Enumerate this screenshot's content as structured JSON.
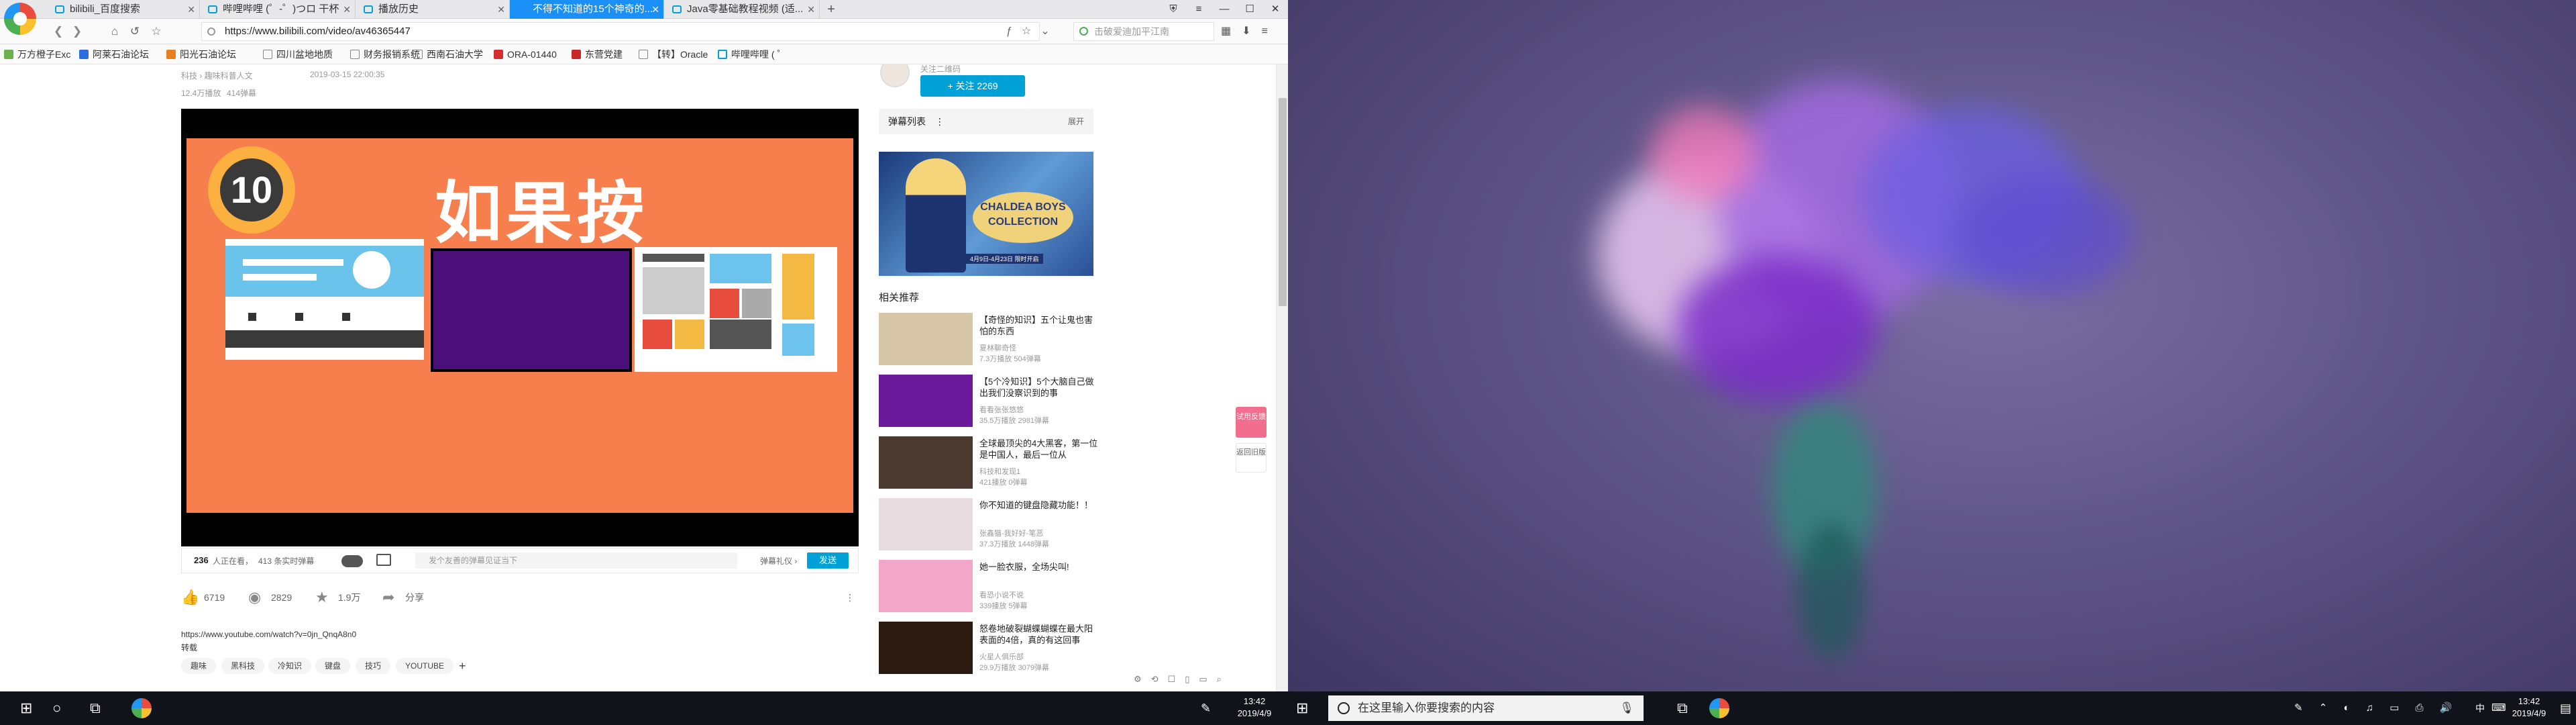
{
  "browser": {
    "tabs": [
      {
        "label": "bilibili_百度搜索",
        "active": false
      },
      {
        "label": "哔哩哔哩 (゜-゜)つロ 干杯",
        "active": false
      },
      {
        "label": "播放历史",
        "active": false
      },
      {
        "label": "不得不知道的15个神奇的...",
        "active": true
      },
      {
        "label": "Java零基础教程视频 (适...",
        "active": false
      }
    ],
    "url": "https://www.bilibili.com/video/av46365447",
    "search_placeholder": "击破爱迪加平江南",
    "bookmarks": [
      "万方橙子Exc",
      "阿莱石油论坛",
      "阳光石油论坛",
      "四川盆地地质",
      "财务报销系统",
      "西南石油大学",
      "ORA-01440",
      "东营党建",
      "【转】Oracle",
      "哔哩哔哩 ( ゜"
    ]
  },
  "video": {
    "category": "科技 › 趣味科普人文",
    "date": "2019-03-15 22:00:35",
    "plays": "12.4万播放",
    "danmaku_count": "414弹幕",
    "frame_badge": "10",
    "frame_title": "如果按",
    "viewers": "236",
    "viewers_suffix": "人正在看，",
    "loaded_danmaku": "413 条实时弹幕",
    "danmu_placeholder": "发个友善的弹幕见证当下",
    "danmu_etiquette": "弹幕礼仪 ›",
    "send_label": "发送",
    "likes": "6719",
    "coins": "2829",
    "favorites": "1.9万",
    "share": "分享",
    "source_url": "https://www.youtube.com/watch?v=0jn_QnqA8n0",
    "source_label": "转载",
    "tags": [
      "趣味",
      "黑科技",
      "冷知识",
      "键盘",
      "技巧",
      "YOUTUBE"
    ]
  },
  "sidebar": {
    "up_sub": "关注二维码",
    "follow_label": "+ 关注 2269",
    "danmu_list_label": "弹幕列表",
    "expand_label": "展开",
    "ad_title": "CHALDEA BOYS COLLECTION",
    "ad_sub": "4月9日-4月23日 限时开启",
    "related_title": "相关推荐",
    "related": [
      {
        "title": "【奇怪的知识】五个让鬼也害怕的东西",
        "up": "夏林聊奇怪",
        "stats": "7.3万播放  504弹幕",
        "color": "#d8c6a8"
      },
      {
        "title": "【5个冷知识】5个大脑自己做出我们没察识到的事",
        "up": "看看张张悠悠",
        "stats": "35.5万播放  2981弹幕",
        "color": "#6a1a9a"
      },
      {
        "title": "全球最顶尖的4大黑客，第一位是中国人，最后一位从",
        "up": "科技和发现1",
        "stats": "421播放  0弹幕",
        "color": "#4a3a30"
      },
      {
        "title": "你不知道的键盘隐藏功能！！",
        "up": "张鑫猫-我好好-笔恶",
        "stats": "37.3万播放  1448弹幕",
        "color": "#e8dce0"
      },
      {
        "title": "她一脸衣服，全场尖叫!",
        "up": "看恐小说不说",
        "stats": "339播放  5弹幕",
        "color": "#f3a6c8"
      },
      {
        "title": "怒卷地破裂蝴蝶蝴蝶在最大阳表面的4倍，真的有这回事",
        "up": "火星人俱乐部",
        "stats": "29.9万播放  3079弹幕",
        "color": "#2a1a10"
      }
    ],
    "float_feedback": "试用反馈",
    "float_back": "返回旧版"
  },
  "taskbar_left": {
    "time": "13:42",
    "date": "2019/4/9"
  },
  "taskbar_right": {
    "search_placeholder": "在这里输入你要搜索的内容",
    "time": "13:42",
    "date": "2019/4/9",
    "ime": "中"
  }
}
